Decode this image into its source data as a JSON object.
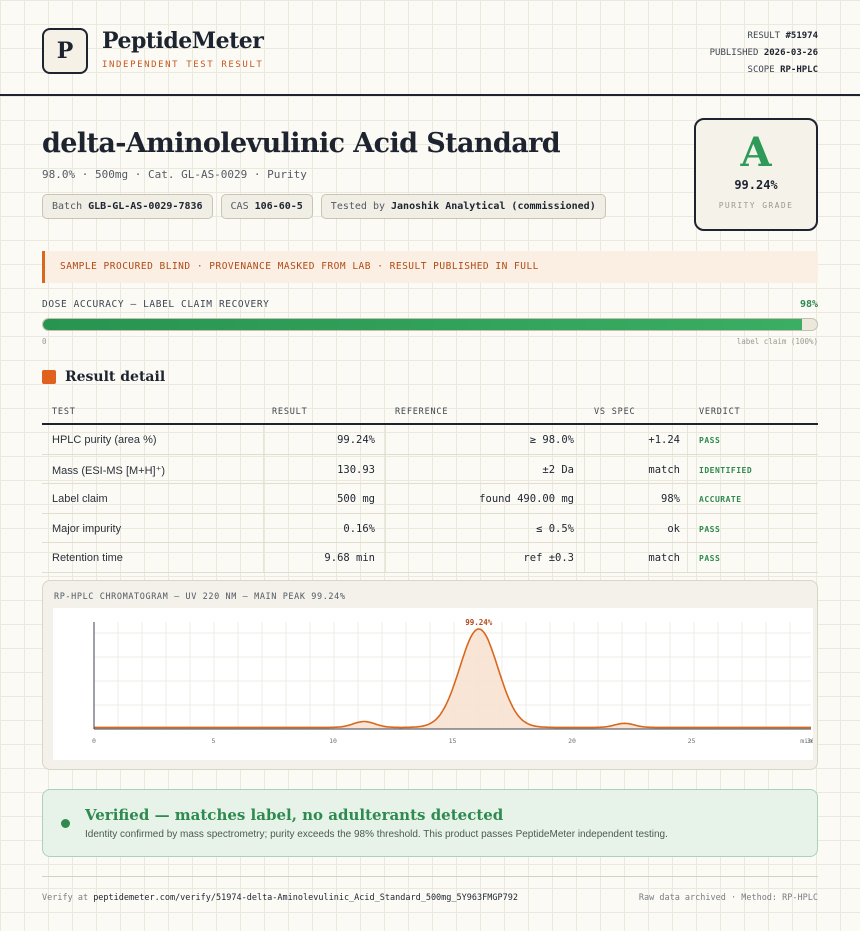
{
  "brand": {
    "logo_letter": "P",
    "name": "PeptideMeter",
    "tagline": "INDEPENDENT TEST RESULT"
  },
  "meta": {
    "result_label": "RESULT",
    "result_value": "#51974",
    "published_label": "PUBLISHED",
    "published_value": "2026-03-26",
    "scope_label": "SCOPE",
    "scope_value": "RP-HPLC"
  },
  "product": {
    "title": "delta-Aminolevulinic Acid Standard",
    "subtitle": "98.0% · 500mg · Cat. GL-AS-0029 · Purity",
    "chips": {
      "batch_label": "Batch",
      "batch_value": "GLB-GL-AS-0029-7836",
      "cas_label": "CAS",
      "cas_value": "106-60-5",
      "tested_label": "Tested by",
      "tested_value": "Janoshik Analytical (commissioned)"
    }
  },
  "grade": {
    "letter": "A",
    "purity": "99.24%",
    "label": "PURITY GRADE"
  },
  "notice": "SAMPLE PROCURED BLIND · PROVENANCE MASKED FROM LAB · RESULT PUBLISHED IN FULL",
  "dose": {
    "label": "DOSE ACCURACY — LABEL CLAIM RECOVERY",
    "percent_text": "98%",
    "fraction": 0.98,
    "zero_label": "0",
    "claim_label": "label claim (100%)"
  },
  "result_detail": {
    "title": "Result detail",
    "headers": {
      "test": "TEST",
      "result": "RESULT",
      "reference": "REFERENCE",
      "vs_spec": "VS SPEC",
      "verdict": "VERDICT"
    },
    "rows": [
      {
        "test": "HPLC purity (area %)",
        "result": "99.24%",
        "reference": "≥ 98.0%",
        "vs_spec": "+1.24",
        "verdict": "PASS"
      },
      {
        "test": "Mass (ESI-MS [M+H]⁺)",
        "result": "130.93",
        "reference": "±2 Da",
        "vs_spec": "match",
        "verdict": "IDENTIFIED"
      },
      {
        "test": "Label claim",
        "result": "500 mg",
        "reference": "found 490.00 mg",
        "vs_spec": "98%",
        "verdict": "ACCURATE"
      },
      {
        "test": "Major impurity",
        "result": "0.16%",
        "reference": "≤ 0.5%",
        "vs_spec": "ok",
        "verdict": "PASS"
      },
      {
        "test": "Retention time",
        "result": "9.68 min",
        "reference": "ref ±0.3",
        "vs_spec": "match",
        "verdict": "PASS"
      }
    ]
  },
  "chart_data": {
    "type": "line",
    "title": "RP-HPLC CHROMATOGRAM — UV 220 NM — MAIN PEAK 99.24%",
    "xlabel": "min",
    "ylabel": "",
    "x_ticks": [
      "0",
      "5",
      "10",
      "15",
      "20",
      "25",
      "30"
    ],
    "xlim": [
      0,
      30
    ],
    "ylim": [
      0,
      100
    ],
    "peak_label": "99.24%",
    "peaks": [
      {
        "rt": 11.3,
        "height": 5.5,
        "width": 0.45
      },
      {
        "rt": 16.1,
        "height": 92,
        "width": 0.8
      },
      {
        "rt": 22.2,
        "height": 3.8,
        "width": 0.4
      }
    ],
    "main_peak": {
      "rt": 16.1,
      "height": 92
    },
    "baseline": 1.5,
    "accent_color": "#d9681f",
    "fill_color": "#f8e2d0"
  },
  "verified": {
    "title": "Verified — matches label, no adulterants detected",
    "text": "Identity confirmed by mass spectrometry; purity exceeds the 98% threshold. This product passes PeptideMeter independent testing."
  },
  "footer": {
    "verify_prefix": "Verify at",
    "verify_url": "peptidemeter.com/verify/51974-delta-Aminolevulinic_Acid_Standard_500mg_5Y963FMGP792",
    "right": "Raw data archived · Method: RP-HPLC"
  }
}
